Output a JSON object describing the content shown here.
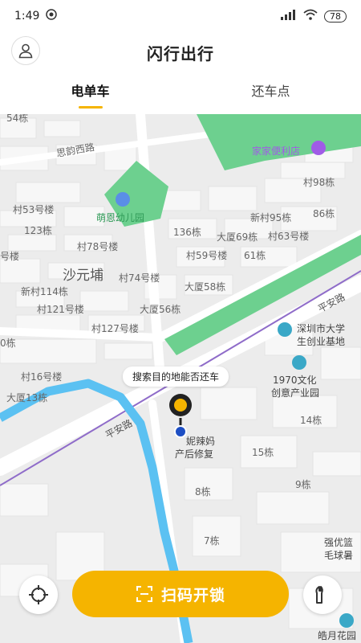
{
  "status_bar": {
    "time": "1:49",
    "battery": "78"
  },
  "header": {
    "title": "闪行出行"
  },
  "tabs": [
    {
      "label": "电单车",
      "active": true
    },
    {
      "label": "还车点",
      "active": false
    }
  ],
  "map": {
    "labels": {
      "l1": "54栋",
      "l2": "思韵西路",
      "l3": "家家便利店",
      "l4": "村98栋",
      "l5": "村53号楼",
      "l6": "萌恩幼儿园",
      "l7": "新村95栋",
      "l8": "86栋",
      "l9": "123栋",
      "l10": "136栋",
      "l11": "大厦69栋",
      "l12": "村63号楼",
      "l13": "村78号楼",
      "l14": "号楼",
      "l15": "村59号楼",
      "l16": "61栋",
      "l17": "沙元埔",
      "l18": "村74号楼",
      "l19": "大厦58栋",
      "l20": "新村114栋",
      "l21": "村121号楼",
      "l22": "大厦56栋",
      "l23": "平安路",
      "l24": "村127号楼",
      "l25": "深圳市大学",
      "l26": "生创业基地",
      "l27": "0栋",
      "l28": "村16号楼",
      "l29": "1970文化",
      "l30": "创意产业园",
      "l31": "大厦13栋",
      "l32": "14栋",
      "l33": "平安路",
      "l34": "妮辣妈",
      "l35": "产后修复",
      "l36": "15栋",
      "l37": "8栋",
      "l38": "9栋",
      "l39": "7栋",
      "l40": "强优篮",
      "l41": "毛球暑",
      "l42": "皓月花园"
    },
    "tooltip": "搜索目的地能否还车"
  },
  "bottom": {
    "scan_label": "扫码开锁"
  },
  "colors": {
    "accent": "#F5B400",
    "park": "#6dd08f",
    "river": "#5bc1f2",
    "rail": "#8f6cc9"
  }
}
